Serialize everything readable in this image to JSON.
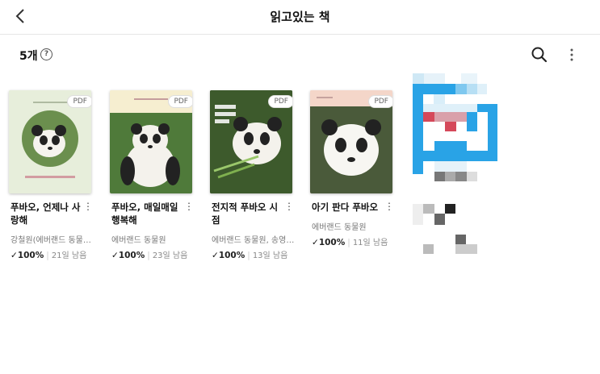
{
  "header": {
    "title": "읽고있는 책"
  },
  "toolbar": {
    "count": "5개",
    "help": "?"
  },
  "books": [
    {
      "title": "푸바오, 언제나 사랑해",
      "author": "강철원(에버랜드 동물…",
      "progress": "100%",
      "days_left": "21일 남음",
      "badge": "PDF",
      "cover_color": "#e7eedb"
    },
    {
      "title": "푸바오, 매일매일 행복해",
      "author": "에버랜드 동물원",
      "progress": "100%",
      "days_left": "23일 남음",
      "badge": "PDF",
      "cover_color": "#f6eed0"
    },
    {
      "title": "전지적 푸바오 시점",
      "author": "에버랜드 동물원, 송영…",
      "progress": "100%",
      "days_left": "13일 남음",
      "badge": "PDF",
      "cover_color": "#3d5a2c"
    },
    {
      "title": "아기 판다 푸바오",
      "author": "에버랜드 동물원",
      "progress": "100%",
      "days_left": "11일 남음",
      "badge": "PDF",
      "cover_color": "#f4d6c9"
    }
  ]
}
